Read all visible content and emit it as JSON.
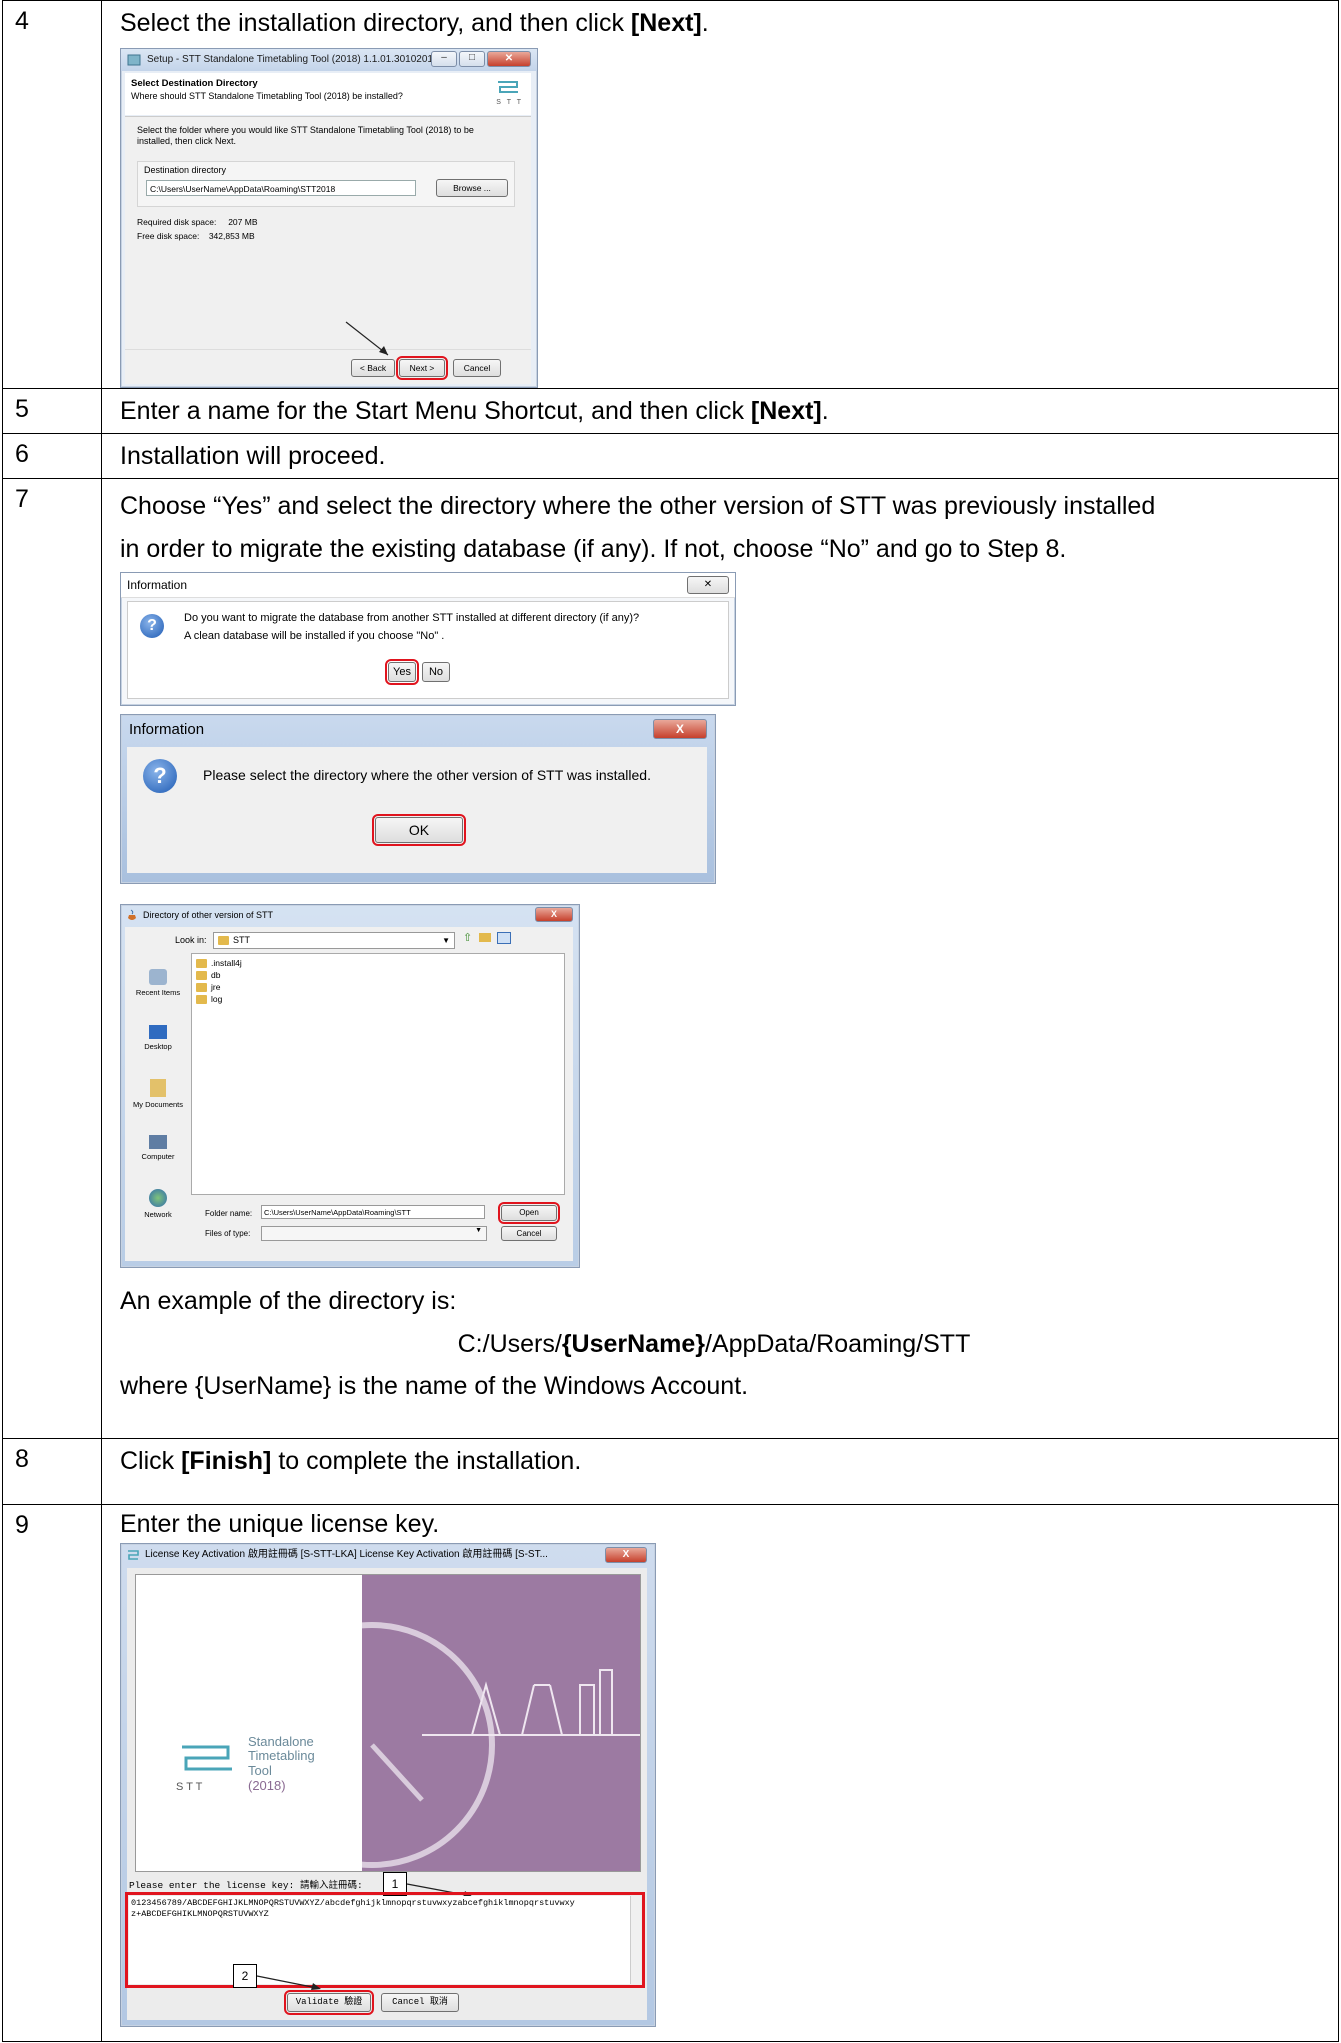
{
  "steps": {
    "s4": {
      "num": "4",
      "text_pre": "Select the installation directory, and then click ",
      "text_bold": "[Next]",
      "text_post": ".",
      "dialog": {
        "title": "Setup - STT Standalone Timetabling Tool (2018) 1.1.01.30102018",
        "heading": "Select Destination Directory",
        "subheading": "Where should STT Standalone Timetabling Tool (2018) be installed?",
        "instruction": "Select the folder where you would like STT Standalone Timetabling Tool (2018) to be installed, then click Next.",
        "dest_label": "Destination directory",
        "dest_value": "C:\\Users\\UserName\\AppData\\Roaming\\STT2018",
        "browse": "Browse ...",
        "req_label": "Required disk space:",
        "req_value": "207 MB",
        "free_label": "Free disk space:",
        "free_value": "342,853 MB",
        "back": "< Back",
        "next": "Next >",
        "cancel": "Cancel",
        "logo_text": "S T T"
      }
    },
    "s5": {
      "num": "5",
      "text_pre": "Enter a name for the Start Menu Shortcut, and then click ",
      "text_bold": "[Next]",
      "text_post": "."
    },
    "s6": {
      "num": "6",
      "text": "Installation will proceed."
    },
    "s7": {
      "num": "7",
      "line1": "Choose “Yes” and select the directory where the other version of STT was previously installed",
      "line2": "in order to migrate the existing database (if any). If not, choose “No” and go to Step 8.",
      "info1": {
        "title": "Information",
        "close": "✕",
        "msg1": "Do you want to migrate the database from another STT installed at different directory (if any)?",
        "msg2": "A clean database will be installed if you choose  \"No\" .",
        "yes": "Yes",
        "no": "No"
      },
      "info2": {
        "title": "Information",
        "msg": "Please select the directory where the other version of STT was installed.",
        "ok": "OK",
        "close": "X"
      },
      "filedlg": {
        "title": "Directory of other version of STT",
        "lookin_label": "Look in:",
        "lookin_value": "STT",
        "files": [
          ".install4j",
          "db",
          "jre",
          "log"
        ],
        "places": [
          "Recent Items",
          "Desktop",
          "My Documents",
          "Computer",
          "Network"
        ],
        "folder_label": "Folder name:",
        "folder_value": "C:\\Users\\UserName\\AppData\\Roaming\\STT",
        "type_label": "Files of type:",
        "open": "Open",
        "cancel": "Cancel"
      },
      "example_intro": "An example of the directory is:",
      "path_pre": "C:/Users/",
      "path_bold": "{UserName}",
      "path_post": "/AppData/Roaming/STT",
      "where": "where {UserName} is the name of the Windows Account."
    },
    "s8": {
      "num": "8",
      "text_pre": "Click ",
      "text_bold": "[Finish]",
      "text_post": " to complete the installation."
    },
    "s9": {
      "num": "9",
      "text": "Enter the unique license key.",
      "dialog": {
        "title": "License Key Activation 啟用註冊碼 [S-STT-LKA] License Key Activation 啟用註冊碼 [S-ST...",
        "brand_line1": "Standalone",
        "brand_line2": "Timetabling",
        "brand_line3": "Tool",
        "brand_line4": "(2018)",
        "logo_text": "S  T  T",
        "prompt": "Please enter the license key: 請輸入註冊碼:",
        "key_line1": "0123456789/ABCDEFGHIJKLMNOPQRSTUVWXYZ/abcdefghijklmnopqrstuvwxyzabcefghiklmnopqrstuvwxy",
        "key_line2": "z+ABCDEFGHIKLMNOPQRSTUVWXYZ",
        "validate": "Validate 驗證",
        "cancel": "Cancel 取消",
        "callout1": "1",
        "callout2": "2"
      }
    }
  }
}
